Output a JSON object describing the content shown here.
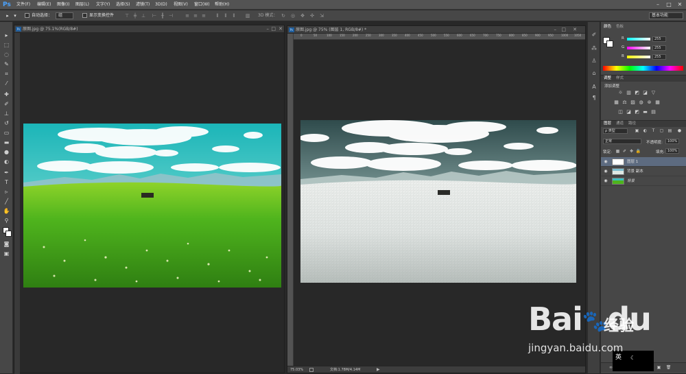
{
  "app": {
    "logo": "Ps"
  },
  "menu": [
    {
      "label": "文件(F)"
    },
    {
      "label": "编辑(E)"
    },
    {
      "label": "图像(I)"
    },
    {
      "label": "图层(L)"
    },
    {
      "label": "文字(Y)"
    },
    {
      "label": "选择(S)"
    },
    {
      "label": "滤镜(T)"
    },
    {
      "label": "3D(D)"
    },
    {
      "label": "视图(V)"
    },
    {
      "label": "窗口(W)"
    },
    {
      "label": "帮助(H)"
    }
  ],
  "window_controls": {
    "minimize": "–",
    "maximize": "□",
    "close": "✕"
  },
  "options": {
    "auto_select_label": "自动选择：",
    "auto_select_value": "组",
    "show_transform_label": "显示变换控件",
    "mode_3d_label": "3D 模式：",
    "workspace": "基本功能"
  },
  "doc_left": {
    "title": "原图.jpg @ 75.1%(RGB/8#)",
    "image": "green meadow with blue sky and clouds"
  },
  "doc_right": {
    "title": "原图.jpg @ 75% (图层 1, RGB/8#) *",
    "ruler_ticks": [
      "0",
      "50",
      "100",
      "150",
      "200",
      "250",
      "300",
      "350",
      "400",
      "450",
      "500",
      "550",
      "600",
      "650",
      "700",
      "750",
      "800",
      "850",
      "900",
      "950",
      "1000",
      "1050"
    ],
    "zoom": "75.03%",
    "doc_size": "文档:1.78M/4.14M",
    "image": "desaturated meadow with clouds"
  },
  "panels": {
    "color_tabs": [
      "颜色",
      "色板"
    ],
    "rgb": [
      {
        "channel": "R",
        "value": "255"
      },
      {
        "channel": "G",
        "value": "255"
      },
      {
        "channel": "B",
        "value": "255"
      }
    ],
    "adjust_tabs": [
      "调整",
      "样式"
    ],
    "adjust_title": "添加调整",
    "layers_tabs": [
      "图层",
      "通道",
      "路径"
    ],
    "kind_label": "ρ 类型",
    "blend_mode": "正常",
    "opacity_label": "不透明度:",
    "opacity_value": "100%",
    "lock_label": "锁定:",
    "fill_label": "填充:",
    "fill_value": "100%",
    "layers": [
      {
        "name": "图层 1",
        "selected": true
      },
      {
        "name": "背景 副本",
        "selected": false
      },
      {
        "name": "背景",
        "selected": false
      }
    ]
  },
  "watermark": {
    "brand": "Bai",
    "paw": "du",
    "jy": "经验",
    "url": "jingyan.baidu.com"
  },
  "ime": {
    "label": "英"
  }
}
